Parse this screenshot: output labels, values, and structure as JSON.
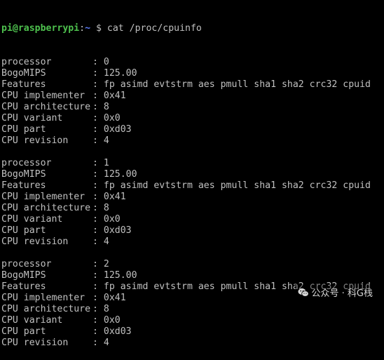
{
  "prompt": {
    "user_host": "pi@raspberrypi",
    "separator": ":",
    "path": "~",
    "symbol": " $",
    "command": " cat /proc/cpuinfo"
  },
  "processors": [
    {
      "fields": [
        {
          "key": "processor",
          "sep": ": ",
          "value": "0"
        },
        {
          "key": "BogoMIPS",
          "sep": ": ",
          "value": "125.00"
        },
        {
          "key": "Features",
          "sep": ": ",
          "value": "fp asimd evtstrm aes pmull sha1 sha2 crc32 cpuid"
        },
        {
          "key": "CPU implementer",
          "sep": ": ",
          "value": "0x41"
        },
        {
          "key": "CPU architecture",
          "sep": ": ",
          "value": "8"
        },
        {
          "key": "CPU variant",
          "sep": ": ",
          "value": "0x0"
        },
        {
          "key": "CPU part",
          "sep": ": ",
          "value": "0xd03"
        },
        {
          "key": "CPU revision",
          "sep": ": ",
          "value": "4"
        }
      ]
    },
    {
      "fields": [
        {
          "key": "processor",
          "sep": ": ",
          "value": "1"
        },
        {
          "key": "BogoMIPS",
          "sep": ": ",
          "value": "125.00"
        },
        {
          "key": "Features",
          "sep": ": ",
          "value": "fp asimd evtstrm aes pmull sha1 sha2 crc32 cpuid"
        },
        {
          "key": "CPU implementer",
          "sep": ": ",
          "value": "0x41"
        },
        {
          "key": "CPU architecture",
          "sep": ": ",
          "value": "8"
        },
        {
          "key": "CPU variant",
          "sep": ": ",
          "value": "0x0"
        },
        {
          "key": "CPU part",
          "sep": ": ",
          "value": "0xd03"
        },
        {
          "key": "CPU revision",
          "sep": ": ",
          "value": "4"
        }
      ]
    },
    {
      "fields": [
        {
          "key": "processor",
          "sep": ": ",
          "value": "2"
        },
        {
          "key": "BogoMIPS",
          "sep": ": ",
          "value": "125.00"
        },
        {
          "key": "Features",
          "sep": ": ",
          "value": "fp asimd evtstrm aes pmull sha1 sha2 crc32 cpuid"
        },
        {
          "key": "CPU implementer",
          "sep": ": ",
          "value": "0x41"
        },
        {
          "key": "CPU architecture",
          "sep": ": ",
          "value": "8"
        },
        {
          "key": "CPU variant",
          "sep": ": ",
          "value": "0x0"
        },
        {
          "key": "CPU part",
          "sep": ": ",
          "value": "0xd03"
        },
        {
          "key": "CPU revision",
          "sep": ": ",
          "value": "4"
        }
      ]
    }
  ],
  "watermark": {
    "icon": "wechat-icon",
    "text": "公众号 · 科G栈"
  },
  "colors": {
    "background": "#000000",
    "text": "#c0c0c0",
    "prompt_user": "#4ec24e",
    "prompt_path": "#5c7cfa"
  }
}
